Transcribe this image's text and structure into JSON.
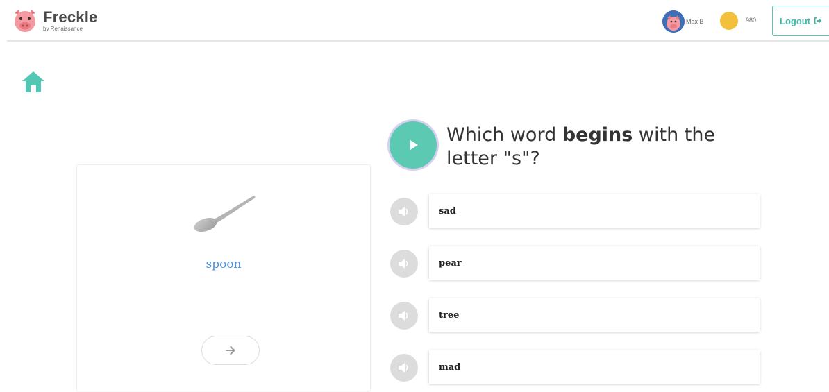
{
  "header": {
    "logo_name": "Freckle",
    "logo_sub": "by Renaissance",
    "user_name": "Max B",
    "coins": "980",
    "logout_label": "Logout"
  },
  "card": {
    "word": "spoon",
    "image_icon": "spoon-icon"
  },
  "question": {
    "part1": "Which word ",
    "part2": "begins",
    "part3": " with the letter \"s\"?"
  },
  "answers": [
    {
      "label": "sad"
    },
    {
      "label": "pear"
    },
    {
      "label": "tree"
    },
    {
      "label": "mad"
    }
  ],
  "colors": {
    "accent": "#5ccab3",
    "word": "#4a90e2",
    "coin": "#f3c03c",
    "pig": "#f08c8c"
  }
}
